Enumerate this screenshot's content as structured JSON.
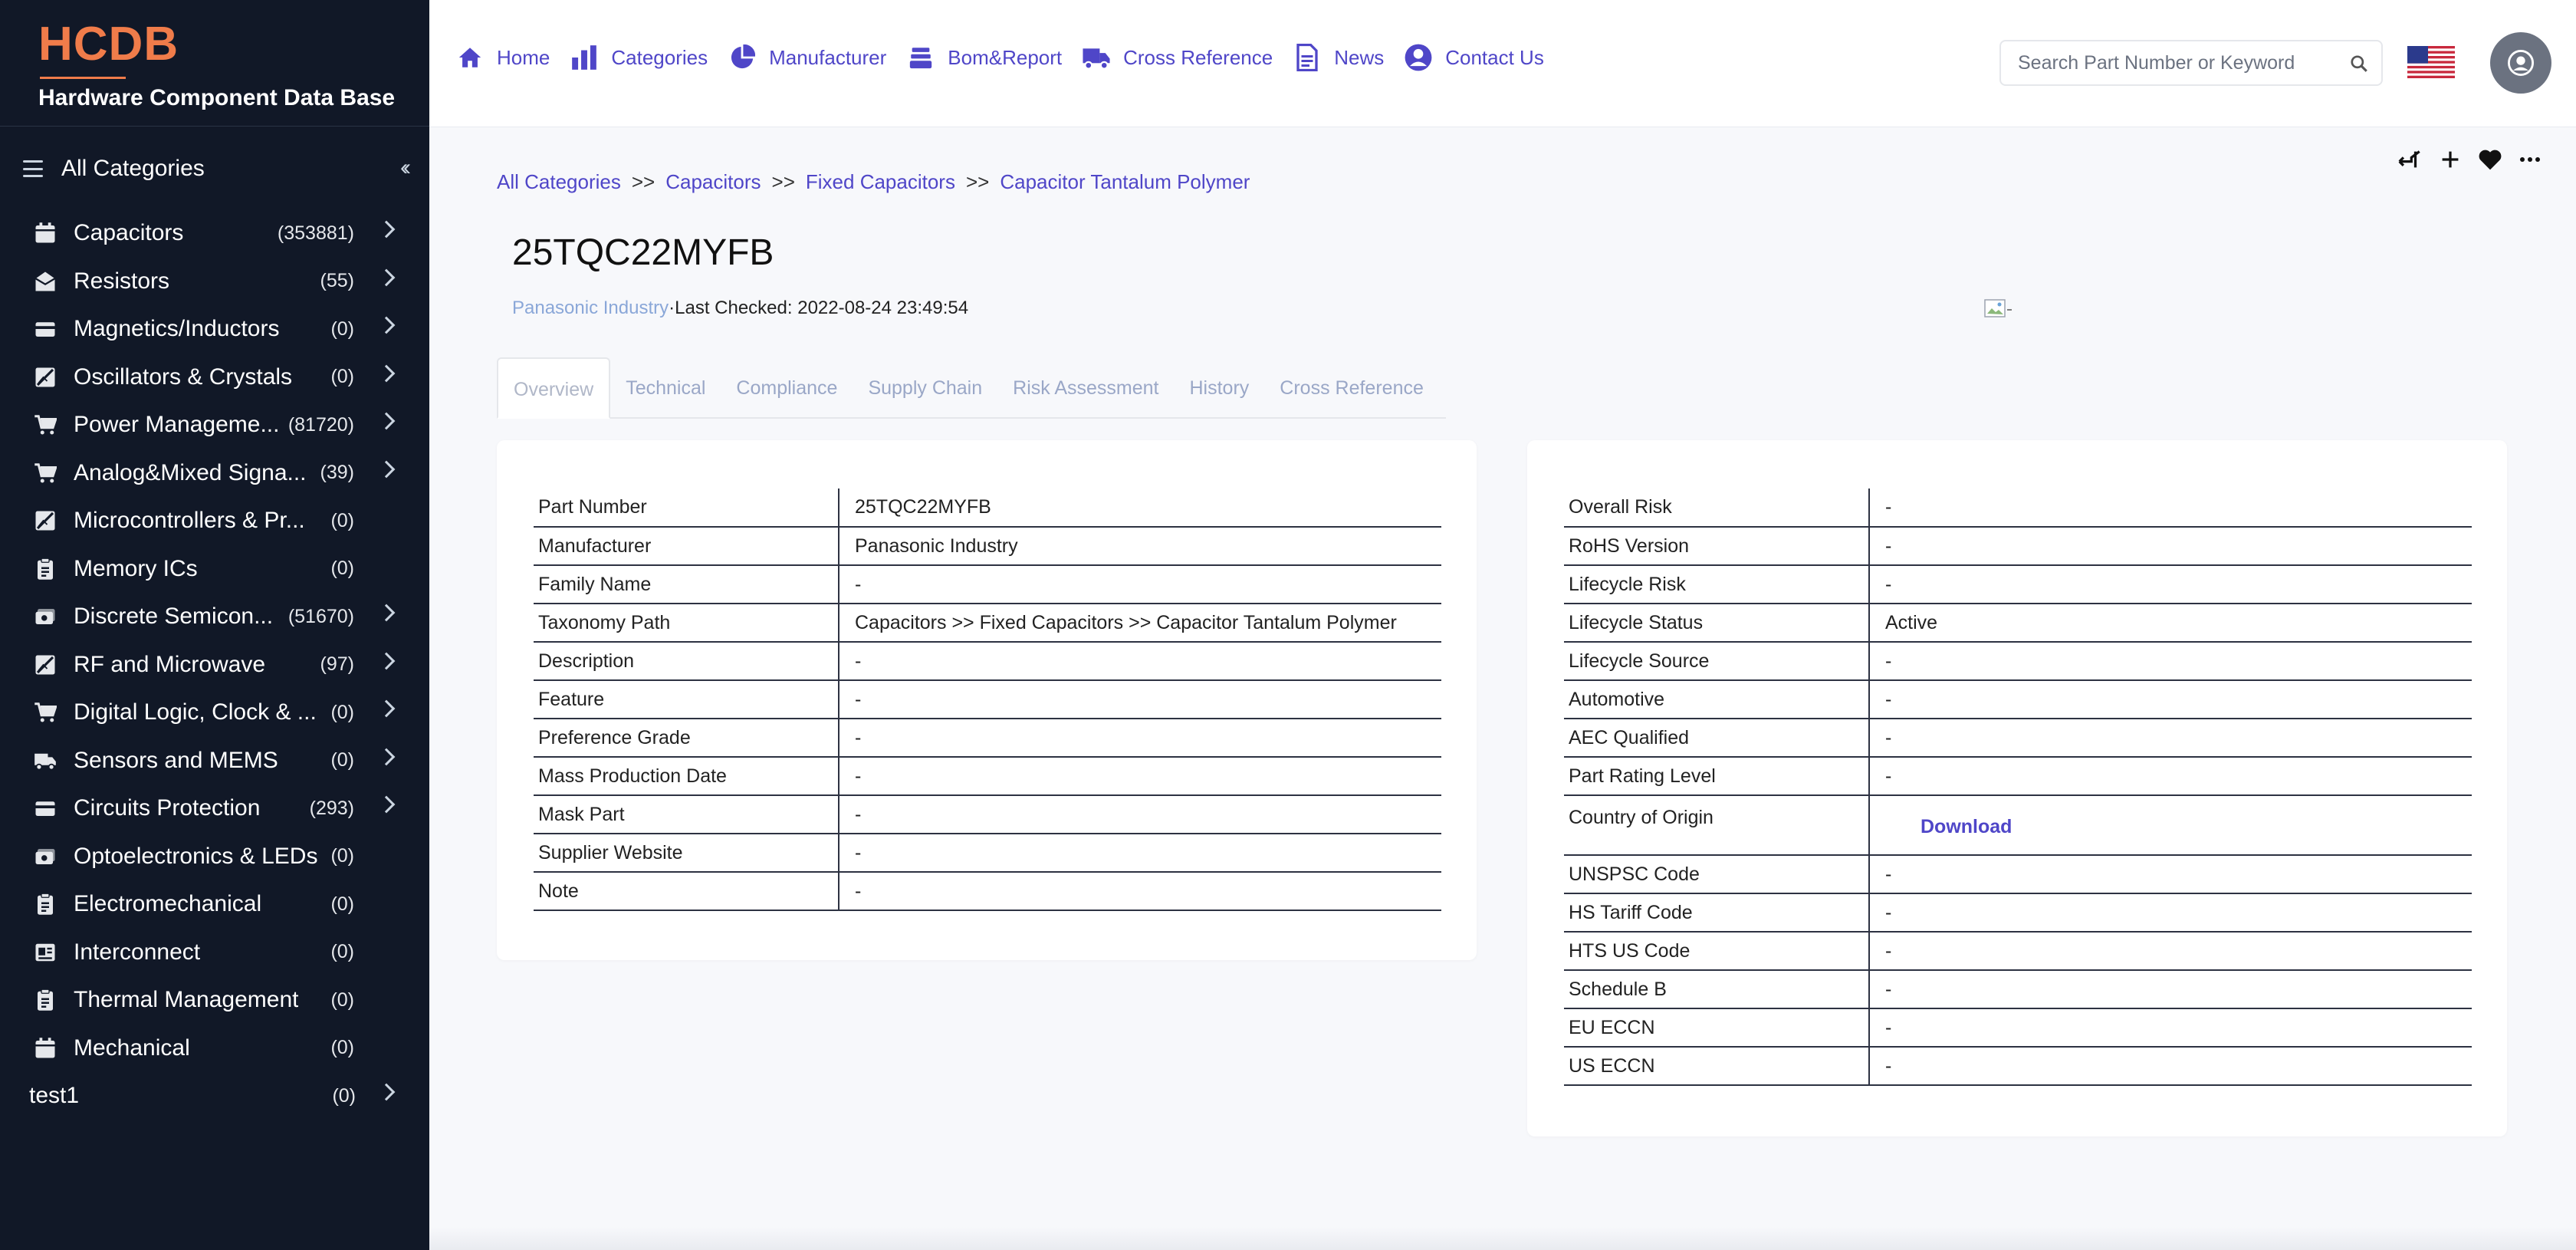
{
  "brand": {
    "logo": "HCDB",
    "subtitle": "Hardware Component Data Base"
  },
  "sidebar": {
    "all_categories": "All Categories",
    "items": [
      {
        "label": "Capacitors",
        "count": "(353881)",
        "icon": "calendar-icon"
      },
      {
        "label": "Resistors",
        "count": "(55)",
        "icon": "envelope-open-icon"
      },
      {
        "label": "Magnetics/Inductors",
        "count": "(0)",
        "icon": "card-icon"
      },
      {
        "label": "Oscillators & Crystals",
        "count": "(0)",
        "icon": "no-image-icon"
      },
      {
        "label": "Power Manageme...",
        "count": "(81720)",
        "icon": "cart-icon"
      },
      {
        "label": "Analog&Mixed Signa...",
        "count": "(39)",
        "icon": "cart-icon"
      },
      {
        "label": "Microcontrollers & Pr...",
        "count": "(0)",
        "icon": "no-image-icon"
      },
      {
        "label": "Memory ICs",
        "count": "(0)",
        "icon": "clipboard-icon"
      },
      {
        "label": "Discrete Semicon...",
        "count": "(51670)",
        "icon": "money-icon"
      },
      {
        "label": "RF and Microwave",
        "count": "(97)",
        "icon": "no-image-icon"
      },
      {
        "label": "Digital Logic, Clock & ...",
        "count": "(0)",
        "icon": "cart-icon"
      },
      {
        "label": "Sensors and MEMS",
        "count": "(0)",
        "icon": "truck-icon"
      },
      {
        "label": "Circuits Protection",
        "count": "(293)",
        "icon": "card-icon"
      },
      {
        "label": "Optoelectronics & LEDs",
        "count": "(0)",
        "icon": "money-icon"
      },
      {
        "label": "Electromechanical",
        "count": "(0)",
        "icon": "clipboard-icon"
      },
      {
        "label": "Interconnect",
        "count": "(0)",
        "icon": "id-card-icon"
      },
      {
        "label": "Thermal Management",
        "count": "(0)",
        "icon": "clipboard-icon"
      },
      {
        "label": "Mechanical",
        "count": "(0)",
        "icon": "calendar-icon"
      },
      {
        "label": "test1",
        "count": "(0)",
        "icon": ""
      }
    ]
  },
  "nav": {
    "home": "Home",
    "categories": "Categories",
    "manufacturer": "Manufacturer",
    "bom_report": "Bom&Report",
    "cross_reference": "Cross Reference",
    "news": "News",
    "contact_us": "Contact Us"
  },
  "search": {
    "placeholder": "Search Part Number or Keyword",
    "value": ""
  },
  "breadcrumb": {
    "items": [
      "All Categories",
      "Capacitors",
      "Fixed Capacitors",
      "Capacitor Tantalum Polymer"
    ],
    "separator": ">>"
  },
  "part": {
    "number": "25TQC22MYFB",
    "manufacturer_link": "Panasonic Industry",
    "separator": "·",
    "last_checked": "Last Checked: 2022-08-24 23:49:54"
  },
  "tabs": [
    "Overview",
    "Technical",
    "Compliance",
    "Supply Chain",
    "Risk Assessment",
    "History",
    "Cross Reference"
  ],
  "overview_left": [
    {
      "k": "Part Number",
      "v": "25TQC22MYFB"
    },
    {
      "k": "Manufacturer",
      "v": "Panasonic Industry"
    },
    {
      "k": "Family Name",
      "v": "-"
    },
    {
      "k": "Taxonomy Path",
      "v": "Capacitors >> Fixed Capacitors >> Capacitor Tantalum Polymer"
    },
    {
      "k": "Description",
      "v": "-"
    },
    {
      "k": "Feature",
      "v": "-"
    },
    {
      "k": "Preference Grade",
      "v": "-"
    },
    {
      "k": "Mass Production Date",
      "v": "-"
    },
    {
      "k": "Mask Part",
      "v": "-"
    },
    {
      "k": "Supplier Website",
      "v": "-"
    },
    {
      "k": "Note",
      "v": "-"
    }
  ],
  "overview_right": [
    {
      "k": "Overall Risk",
      "v": "-"
    },
    {
      "k": "RoHS Version",
      "v": "-"
    },
    {
      "k": "Lifecycle Risk",
      "v": "-"
    },
    {
      "k": "Lifecycle Status",
      "v": "Active"
    },
    {
      "k": "Lifecycle Source",
      "v": "-"
    },
    {
      "k": "Automotive",
      "v": "-"
    },
    {
      "k": "AEC Qualified",
      "v": "-"
    },
    {
      "k": "Part Rating Level",
      "v": "-"
    },
    {
      "k": "Country of Origin",
      "v": "Download"
    },
    {
      "k": "UNSPSC Code",
      "v": "-"
    },
    {
      "k": "HS Tariff Code",
      "v": "-"
    },
    {
      "k": "HTS US Code",
      "v": "-"
    },
    {
      "k": "Schedule B",
      "v": "-"
    },
    {
      "k": "EU ECCN",
      "v": "-"
    },
    {
      "k": "US ECCN",
      "v": "-"
    }
  ],
  "colors": {
    "accent": "#4f46c8",
    "brand": "#f07c4a",
    "sidebar": "#111827"
  }
}
